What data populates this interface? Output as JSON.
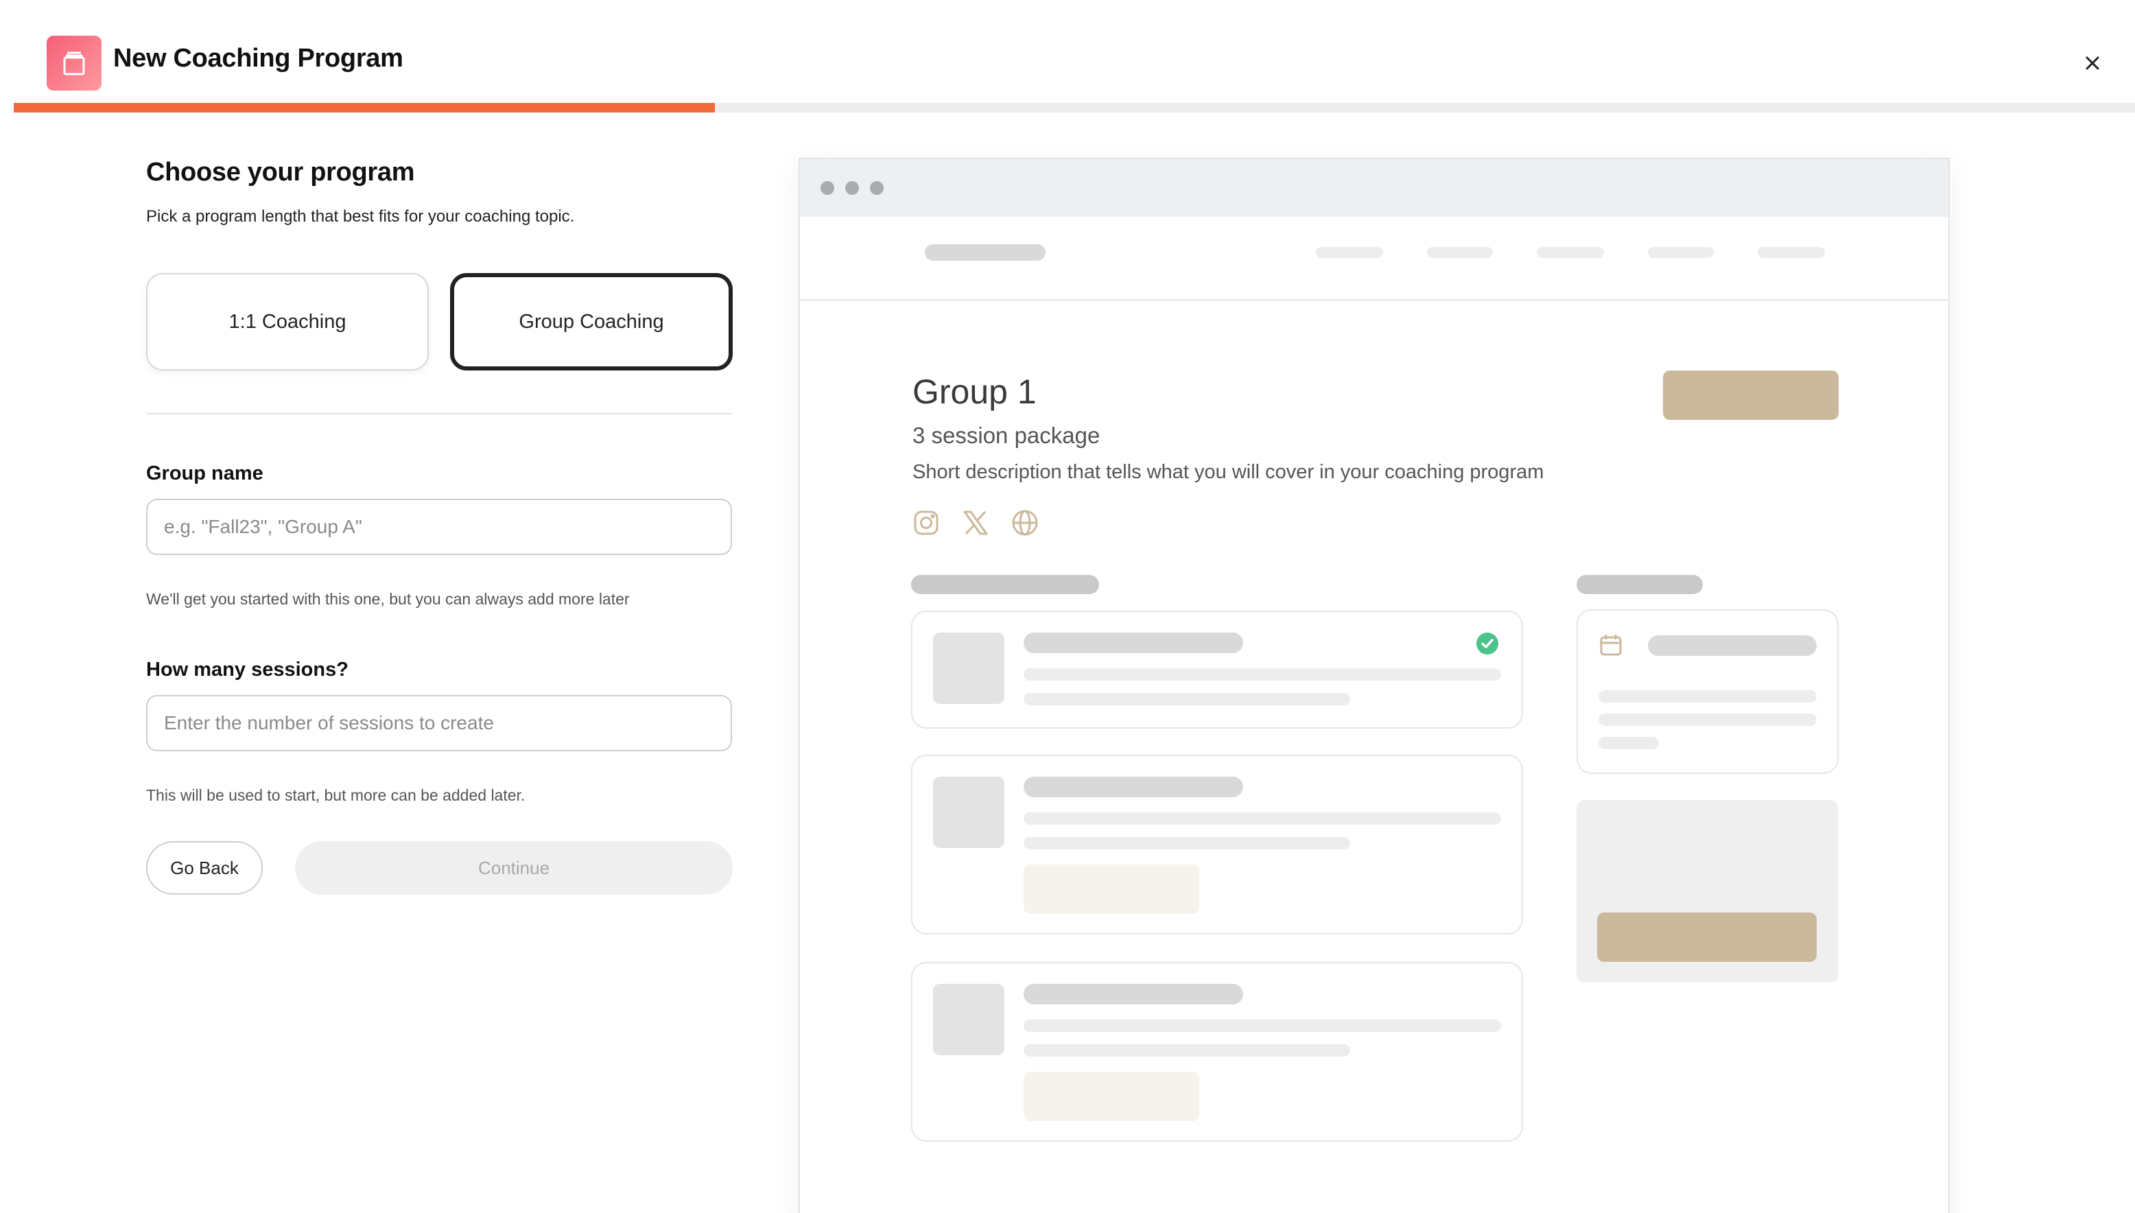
{
  "header": {
    "title": "New Coaching Program",
    "icon": "calendar-icon",
    "close_icon": "close-icon",
    "progress": 0.33,
    "accent_color": "#f26a3d"
  },
  "form": {
    "title": "Choose your program",
    "subtitle": "Pick a program length that best fits for your coaching topic.",
    "options": [
      {
        "label": "1:1 Coaching",
        "selected": false
      },
      {
        "label": "Group Coaching",
        "selected": true
      }
    ],
    "group_name": {
      "label": "Group name",
      "value": "",
      "placeholder": "e.g. \"Fall23\", \"Group A\"",
      "helper": "We'll get you started with this one, but you can always add more later"
    },
    "sessions": {
      "label": "How many sessions?",
      "value": "",
      "placeholder": "Enter the number of sessions to create",
      "helper": "This will be used to start, but more can be added later."
    },
    "back_label": "Go Back",
    "continue_label": "Continue"
  },
  "preview": {
    "title": "Group 1",
    "subtitle": "3 session package",
    "description": "Short description that tells what you will cover in your coaching program",
    "social_icons": [
      "instagram-icon",
      "x-icon",
      "globe-icon"
    ],
    "brand_color": "#cbb99b",
    "check_color": "#4cc38a"
  }
}
